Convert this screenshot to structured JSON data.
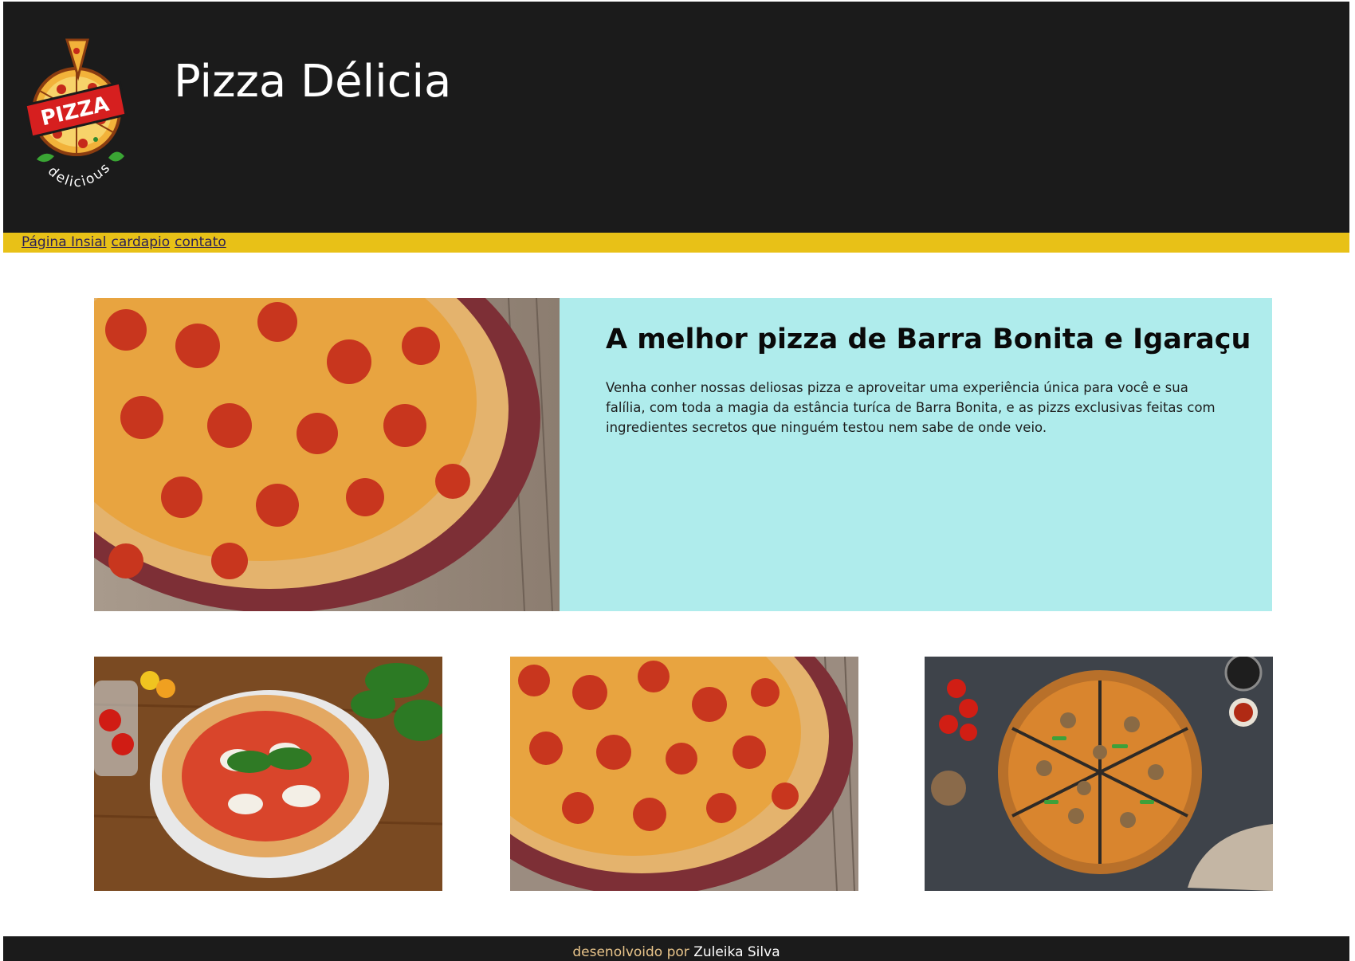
{
  "header": {
    "logo_text": "PIZZA",
    "logo_subtext": "delicious",
    "title": "Pizza Délicia"
  },
  "nav": {
    "items": [
      {
        "label": "Página Insial"
      },
      {
        "label": "cardapio"
      },
      {
        "label": "contato"
      }
    ]
  },
  "hero": {
    "heading": "A melhor pizza de Barra Bonita e Igaraçu",
    "paragraph": "Venha conher nossas deliosas pizza e aproveitar uma experiência única para você e sua falília, com toda a magia da estância turíca de Barra Bonita, e as pizzs exclusivas feitas com ingredientes secretos que ninguém testou nem sabe de onde veio.",
    "image": "pepperoni-pizza-photo"
  },
  "gallery": [
    {
      "image": "margherita-pizza-photo"
    },
    {
      "image": "pepperoni-pizza-photo"
    },
    {
      "image": "sausage-pepper-pizza-photo"
    }
  ],
  "footer": {
    "prefix": "desenolvoido por",
    "author": "Zuleika Silva"
  },
  "colors": {
    "header_bg": "#1b1b1b",
    "nav_bg": "#e8c117",
    "hero_text_bg": "#afecec",
    "footer_prefix": "#e8c48a"
  }
}
